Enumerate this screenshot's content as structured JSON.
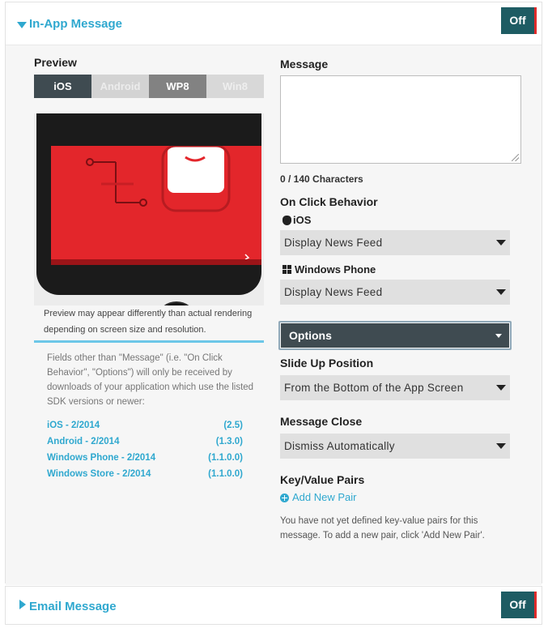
{
  "in_app": {
    "title": "In-App Message",
    "toggle": "Off",
    "preview": {
      "label": "Preview",
      "tabs": [
        "iOS",
        "Android",
        "WP8",
        "Win8"
      ],
      "note": "Preview may appear differently than actual rendering depending on screen size and resolution."
    },
    "fields_note": "Fields other than \"Message\" (i.e. \"On Click Behavior\", \"Options\") will only be received by downloads of your application which use the listed SDK versions or newer:",
    "sdks": [
      {
        "name": "iOS - 2/2014",
        "version": "(2.5)"
      },
      {
        "name": "Android - 2/2014",
        "version": "(1.3.0)"
      },
      {
        "name": "Windows Phone - 2/2014",
        "version": "(1.1.0.0)"
      },
      {
        "name": "Windows Store - 2/2014",
        "version": "(1.1.0.0)"
      }
    ],
    "message": {
      "label": "Message",
      "value": "",
      "char_count": "0 / 140 Characters"
    },
    "on_click": {
      "label": "On Click Behavior",
      "ios_label": "iOS",
      "ios_value": "Display News Feed",
      "wp_label": "Windows Phone",
      "wp_value": "Display News Feed"
    },
    "options_label": "Options",
    "slide_up": {
      "label": "Slide Up Position",
      "value": "From the Bottom of the App Screen"
    },
    "message_close": {
      "label": "Message Close",
      "value": "Dismiss Automatically"
    },
    "kv": {
      "label": "Key/Value Pairs",
      "add_label": "Add New Pair",
      "note": "You have not yet defined key-value pairs for this message. To add a new pair, click 'Add New Pair'."
    }
  },
  "email": {
    "title": "Email Message",
    "toggle": "Off"
  },
  "colors": {
    "accent": "#2fa8cf",
    "toggle_bg": "#1e5c63",
    "toggle_edge": "#e02b2b",
    "dark_button": "#3f4b51"
  }
}
